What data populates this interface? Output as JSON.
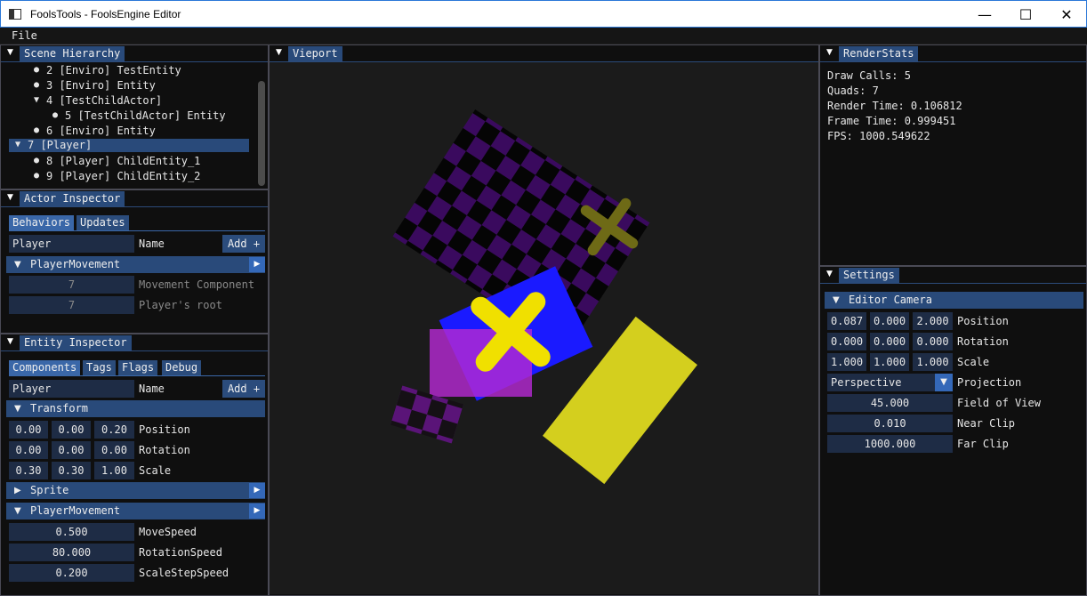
{
  "window": {
    "title": "FoolsTools - FoolsEngine Editor",
    "minimize": "—",
    "maximize": "☐",
    "close": "✕"
  },
  "menu": {
    "file": "File"
  },
  "scene_hierarchy": {
    "tab": "Scene Hierarchy",
    "items": [
      {
        "bullet": "●",
        "label": "2 [Enviro] TestEntity"
      },
      {
        "bullet": "●",
        "label": "3 [Enviro] Entity"
      },
      {
        "bullet": "▼",
        "label": "4 [TestChildActor]"
      },
      {
        "bullet": "●",
        "label": "5 [TestChildActor] Entity"
      },
      {
        "bullet": "●",
        "label": "6 [Enviro] Entity"
      },
      {
        "bullet": "▼",
        "label": "7 [Player]"
      },
      {
        "bullet": "●",
        "label": "8 [Player] ChildEntity_1"
      },
      {
        "bullet": "●",
        "label": "9 [Player] ChildEntity_2"
      }
    ]
  },
  "actor_inspector": {
    "tab": "Actor Inspector",
    "subtabs": [
      "Behaviors",
      "Updates"
    ],
    "name_value": "Player",
    "name_label": "Name",
    "add_button": "Add +",
    "section": "PlayerMovement",
    "rows": [
      {
        "value": "7",
        "label": "Movement Component"
      },
      {
        "value": "7",
        "label": "Player's root"
      }
    ]
  },
  "entity_inspector": {
    "tab": "Entity Inspector",
    "subtabs": [
      "Components",
      "Tags",
      "Flags",
      "Debug"
    ],
    "name_value": "Player",
    "name_label": "Name",
    "add_button": "Add +",
    "transform": {
      "header": "Transform",
      "position": {
        "x": "0.00",
        "y": "0.00",
        "z": "0.20",
        "label": "Position"
      },
      "rotation": {
        "x": "0.00",
        "y": "0.00",
        "z": "0.00",
        "label": "Rotation"
      },
      "scale": {
        "x": "0.30",
        "y": "0.30",
        "z": "1.00",
        "label": "Scale"
      }
    },
    "sprite_header": "Sprite",
    "movement": {
      "header": "PlayerMovement",
      "rows": [
        {
          "value": "0.500",
          "label": "MoveSpeed"
        },
        {
          "value": "80.000",
          "label": "RotationSpeed"
        },
        {
          "value": "0.200",
          "label": "ScaleStepSpeed"
        }
      ]
    }
  },
  "viewport": {
    "tab": "Vieport"
  },
  "render_stats": {
    "tab": "RenderStats",
    "lines": [
      "Draw Calls: 5",
      "Quads: 7",
      "Render Time: 0.106812",
      "Frame Time: 0.999451",
      "FPS: 1000.549622"
    ]
  },
  "settings": {
    "tab": "Settings",
    "section": "Editor Camera",
    "position": {
      "x": "0.087",
      "y": "0.000",
      "z": "2.000",
      "label": "Position"
    },
    "rotation": {
      "x": "0.000",
      "y": "0.000",
      "z": "0.000",
      "label": "Rotation"
    },
    "scale": {
      "x": "1.000",
      "y": "1.000",
      "z": "1.000",
      "label": "Scale"
    },
    "projection": {
      "value": "Perspective",
      "label": "Projection"
    },
    "fov": {
      "value": "45.000",
      "label": "Field of View"
    },
    "near": {
      "value": "0.010",
      "label": "Near Clip"
    },
    "far": {
      "value": "1000.000",
      "label": "Far Clip"
    }
  },
  "colors": {
    "panel_tab": "#294a7a",
    "field_bg": "#1e2c45",
    "accent_button": "#3468b8",
    "viewport_bg": "#1b1b1b",
    "sprite_purple": "#3a0a5e",
    "sprite_blue": "#1a1aff",
    "sprite_magenta": "#b42ad2",
    "sprite_yellow": "#d4cf1e",
    "cross_yellow": "#f0e000",
    "cross_olive": "#6e6a16"
  }
}
